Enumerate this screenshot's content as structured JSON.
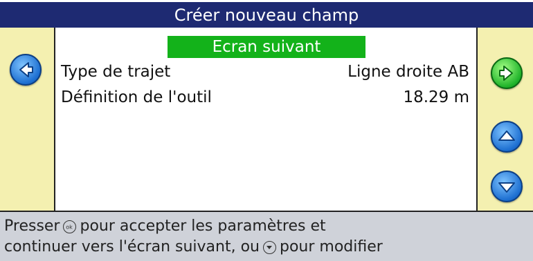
{
  "title": "Créer nouveau champ",
  "next_screen_label": "Ecran suivant",
  "settings": [
    {
      "label": "Type de trajet",
      "value": "Ligne droite AB"
    },
    {
      "label": "Définition de l'outil",
      "value": "18.29 m"
    }
  ],
  "status": {
    "line1_before_icon": "Presser",
    "line1_after_icon": "pour accepter les paramètres et",
    "line2_before_icon": "continuer vers l'écran suivant, ou",
    "line2_after_icon": "pour modifier"
  },
  "buttons": {
    "back_icon": "arrow-left-icon",
    "next_icon": "arrow-right-icon",
    "up_icon": "arrow-up-icon",
    "down_icon": "arrow-down-icon",
    "ok_icon": "ok-button-icon",
    "down_key_icon": "down-key-icon"
  },
  "colors": {
    "title_bg": "#1e2a72",
    "rail_bg": "#f4f0b0",
    "next_bar_bg": "#13b21a",
    "status_bg": "#cfd2d9",
    "blue_button": "#1d6fd1",
    "green_button": "#1fb32a"
  }
}
